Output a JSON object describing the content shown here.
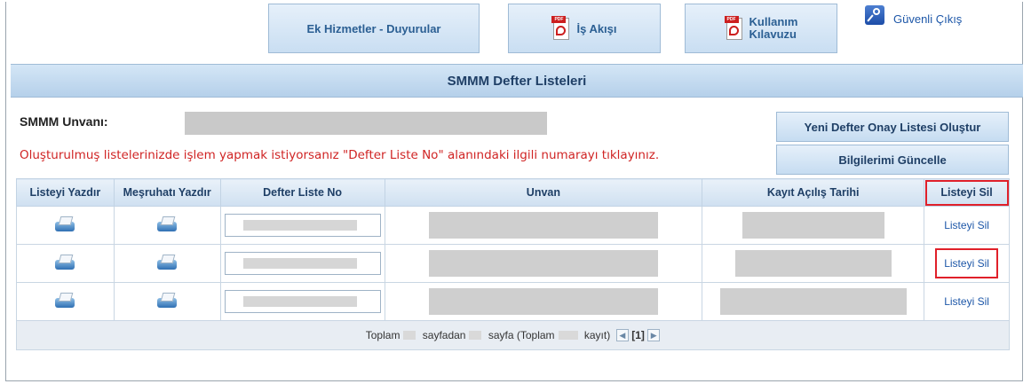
{
  "top_nav": {
    "ek_hizmetler": "Ek Hizmetler - Duyurular",
    "is_akisi": "İş Akışı",
    "kullanim_line1": "Kullanım",
    "kullanim_line2": "Kılavuzu",
    "pdf_tag": "PDF",
    "logout": "Güvenli Çıkış"
  },
  "panel": {
    "title": "SMMM Defter Listeleri",
    "unvan_label": "SMMM Unvanı:",
    "info_text": "Oluşturulmuş listelerinizde işlem yapmak istiyorsanız \"Defter Liste No\" alanındaki ilgili numarayı tıklayınız.",
    "new_list_button": "Yeni Defter Onay Listesi Oluştur",
    "update_info_button": "Bilgilerimi Güncelle"
  },
  "table": {
    "headers": [
      "Listeyi Yazdır",
      "Meşruhatı Yazdır",
      "Defter Liste No",
      "Unvan",
      "Kayıt Açılış Tarihi",
      "Listeyi Sil"
    ],
    "rows": [
      {
        "delete_label": "Listeyi Sil"
      },
      {
        "delete_label": "Listeyi Sil"
      },
      {
        "delete_label": "Listeyi Sil"
      }
    ]
  },
  "pagination": {
    "toplam": "Toplam",
    "sayfadan": "sayfadan",
    "sayfa_toplam": "sayfa (Toplam",
    "kayit": "kayıt)",
    "current_page": "[1]"
  },
  "colors": {
    "highlight": "#e0202a",
    "info_text": "#d02424",
    "link": "#1d57a8"
  }
}
